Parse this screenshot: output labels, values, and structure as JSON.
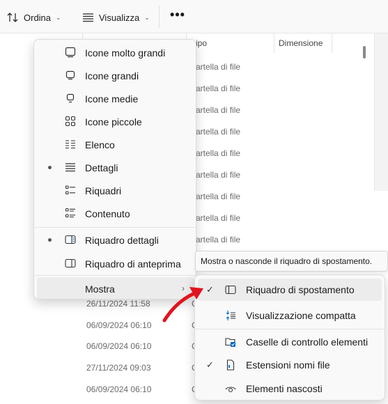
{
  "toolbar": {
    "sort_label": "Ordina",
    "view_label": "Visualizza",
    "more_label": "•••"
  },
  "columns": {
    "type": "ipo",
    "size": "Dimensione"
  },
  "rows": [
    {
      "type": "artella di file"
    },
    {
      "type": "artella di file"
    },
    {
      "type": "artella di file"
    },
    {
      "type": "artella di file"
    },
    {
      "type": "artella di file"
    },
    {
      "type": "artella di file"
    },
    {
      "type": "artella di file"
    },
    {
      "type": "artella di file"
    },
    {
      "type": "artella di file"
    }
  ],
  "dates": [
    {
      "date": "26/11/2024 11:58",
      "t": "C"
    },
    {
      "date": "06/09/2024 06:10",
      "t": "C"
    },
    {
      "date": "06/09/2024 06:10",
      "t": "C"
    },
    {
      "date": "27/11/2024 09:03",
      "t": "C"
    },
    {
      "date": "06/09/2024 06:10",
      "t": "C"
    }
  ],
  "view_menu": {
    "items": [
      {
        "label": "Icone molto grandi",
        "icon": "extra-large-icons-icon",
        "selected": false
      },
      {
        "label": "Icone grandi",
        "icon": "large-icons-icon",
        "selected": false
      },
      {
        "label": "Icone medie",
        "icon": "medium-icons-icon",
        "selected": false
      },
      {
        "label": "Icone piccole",
        "icon": "small-icons-icon",
        "selected": false
      },
      {
        "label": "Elenco",
        "icon": "list-icon",
        "selected": false
      },
      {
        "label": "Dettagli",
        "icon": "details-icon",
        "selected": true
      },
      {
        "label": "Riquadri",
        "icon": "tiles-icon",
        "selected": false
      },
      {
        "label": "Contenuto",
        "icon": "content-icon",
        "selected": false
      }
    ],
    "pane_items": [
      {
        "label": "Riquadro dettagli",
        "icon": "details-pane-icon",
        "selected": true
      },
      {
        "label": "Riquadro di anteprima",
        "icon": "preview-pane-icon",
        "selected": false
      }
    ],
    "show_label": "Mostra"
  },
  "tooltip": "Mostra o nasconde il riquadro di spostamento.",
  "show_submenu": {
    "items": [
      {
        "label": "Riquadro di spostamento",
        "icon": "navigation-pane-icon",
        "checked": true
      },
      {
        "label": "Visualizzazione compatta",
        "icon": "compact-view-icon",
        "checked": false
      },
      {
        "label": "Caselle di controllo elementi",
        "icon": "item-checkboxes-icon",
        "checked": false
      },
      {
        "label": "Estensioni nomi file",
        "icon": "file-extensions-icon",
        "checked": true
      },
      {
        "label": "Elementi nascosti",
        "icon": "hidden-items-icon",
        "checked": false
      }
    ]
  },
  "colors": {
    "accent": "#0067c0",
    "annotation": "#e0141e"
  }
}
